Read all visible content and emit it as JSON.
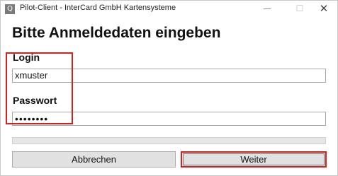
{
  "window": {
    "title": "Pilot-Client - InterCard GmbH Kartensysteme",
    "icon_label": "Q",
    "icon_name": "app-q-icon",
    "controls": {
      "minimize": "—",
      "maximize": "☐",
      "close": "✕"
    }
  },
  "form": {
    "heading": "Bitte Anmeldedaten eingeben",
    "login_label": "Login",
    "login_value": "xmuster",
    "password_label": "Passwort",
    "password_value": "••••••••"
  },
  "progress": {
    "value": 0
  },
  "buttons": {
    "cancel_label": "Abbrechen",
    "next_label": "Weiter"
  },
  "colors": {
    "highlight": "#d62020",
    "button_bg": "#e1e1e1"
  }
}
